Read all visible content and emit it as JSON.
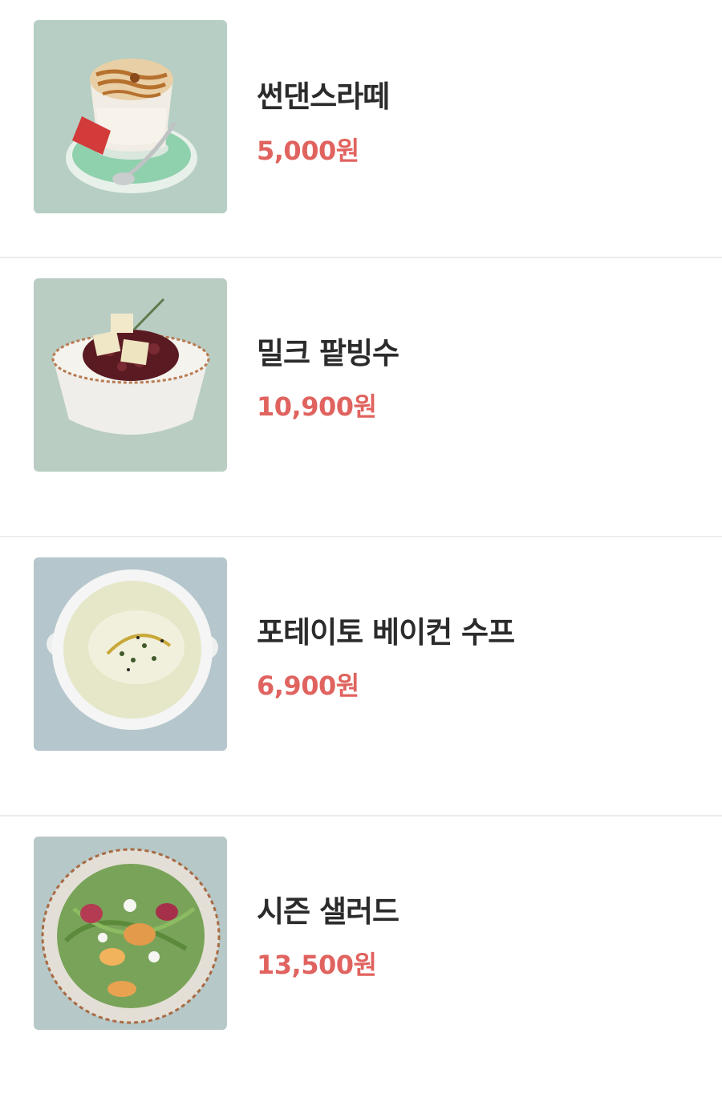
{
  "menu": {
    "items": [
      {
        "name": "썬댄스라떼",
        "price": "5,000원"
      },
      {
        "name": "밀크 팥빙수",
        "price": "10,900원"
      },
      {
        "name": "포테이토 베이컨 수프",
        "price": "6,900원"
      },
      {
        "name": "시즌 샐러드",
        "price": "13,500원"
      }
    ]
  },
  "colors": {
    "price": "#e0635f",
    "divider": "#ececec"
  }
}
